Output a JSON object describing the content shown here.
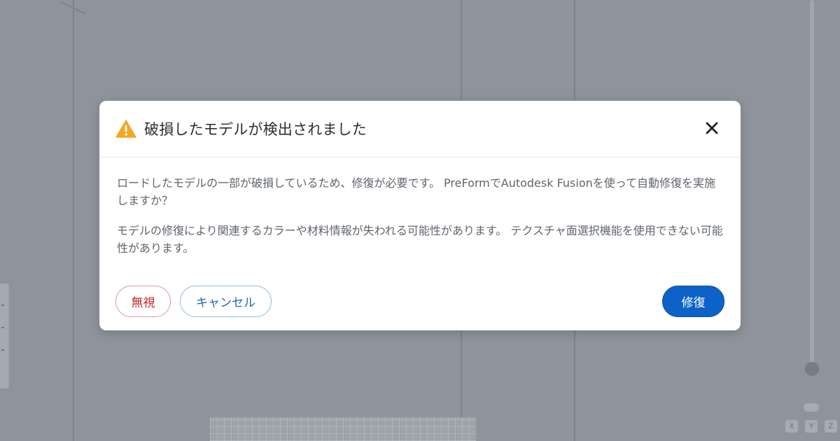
{
  "dialog": {
    "title": "破損したモデルが検出されました",
    "message1": "ロードしたモデルの一部が破損しているため、修復が必要です。 PreFormでAutodesk Fusionを使って自動修復を実施しますか？",
    "message2": "モデルの修復により関連するカラーや材料情報が失われる可能性があります。 テクスチャ面選択機能を使用できない可能性があります。",
    "buttons": {
      "ignore": "無視",
      "cancel": "キャンセル",
      "repair": "修復"
    },
    "icons": {
      "warning": "warning-icon",
      "close": "close-icon"
    }
  },
  "viewer": {
    "axis_labels": [
      "X",
      "Y",
      "Z"
    ]
  },
  "colors": {
    "warning": "#f5a623",
    "primary": "#0d62c8",
    "danger": "#c62828",
    "secondary": "#1d69b5",
    "overlay": "#8f949c"
  }
}
